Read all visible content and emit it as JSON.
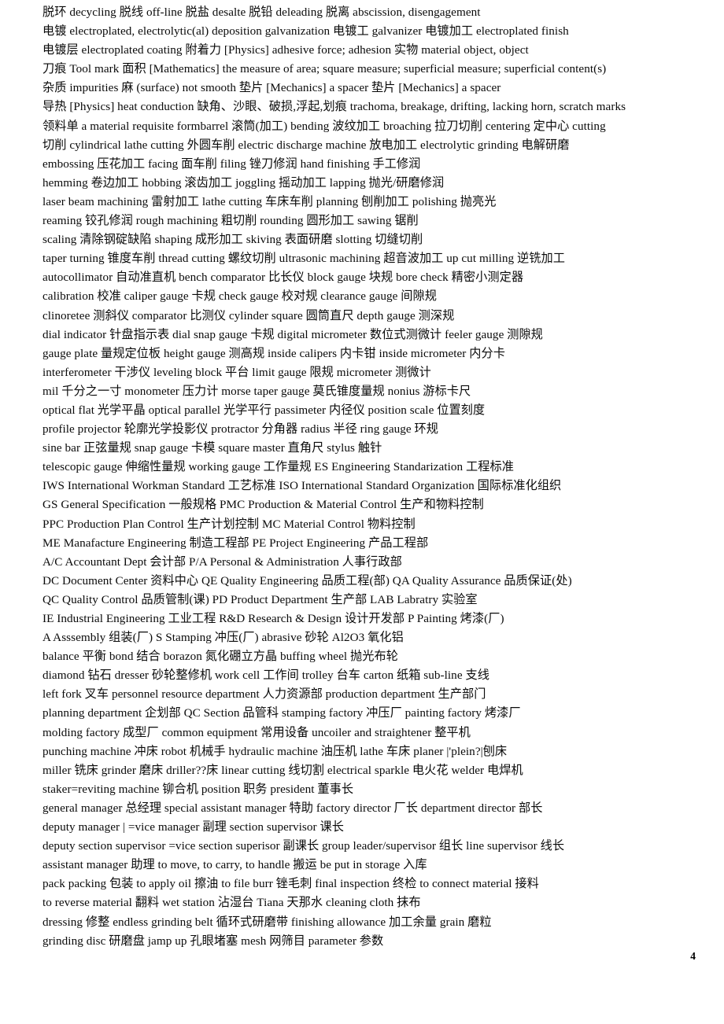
{
  "document": {
    "type": "bilingual-glossary",
    "page_number": "4",
    "lines": [
      "脱环  decycling 脱线  off-line 脱盐  desalte 脱铅  deleading 脱离  abscission, disengagement",
      "电镀  electroplated, electrolytic(al) deposition galvanization 电镀工  galvanizer 电镀加工  electroplated finish",
      "电镀层  electroplated coating  附着力  [Physics] adhesive force; adhesion 实物  material object, object",
      "刀痕  Tool mark 面积  [Mathematics] the measure of area; square measure; superficial measure; superficial content(s)",
      "杂质  impurities 麻  (surface) not smooth 垫片  [Mechanics] a spacer 垫片  [Mechanics] a spacer",
      "导热  [Physics] heat conduction 缺角、沙眼、破损,浮起,划痕  trachoma, breakage, drifting, lacking horn, scratch marks",
      "领料单  a material requisite formbarrel  滚筒(加工) bending  波纹加工  broaching  拉刀切削  centering  定中心  cutting",
      "切削  cylindrical lathe cutting  外圆车削  electric discharge machine  放电加工  electrolytic grinding  电解研磨",
      "embossing  压花加工  facing  面车削  filing  锉刀修润  hand finishing  手工修润",
      "hemming  卷边加工  hobbing  滚齿加工  joggling  摇动加工  lapping  抛光/研磨修润",
      "laser beam machining  雷射加工  lathe cutting  车床车削  planning  刨削加工  polishing  抛亮光",
      "reaming  铰孔修润  rough machining  粗切削  rounding  圆形加工  sawing  锯削",
      "scaling  清除钢碇缺陷  shaping  成形加工  skiving  表面研磨  slotting  切缝切削",
      "taper turning  锥度车削  thread cutting  螺纹切削  ultrasonic machining  超音波加工  up cut milling  逆铣加工",
      "autocollimator  自动准直机  bench comparator  比长仪  block gauge  块规  bore check  精密小测定器",
      "calibration  校准  caliper gauge 卡规  check gauge  校对规  clearance gauge  间隙规",
      "clinoretee  测斜仪  comparator  比测仪  cylinder square  圆筒直尺  depth gauge  测深规",
      "dial indicator  针盘指示表  dial snap gauge  卡规  digital micrometer  数位式测微计  feeler gauge  测隙规",
      "gauge plate  量规定位板  height gauge  测高规  inside calipers  内卡钳  inside micrometer  内分卡",
      "interferometer  干涉仪  leveling block  平台  limit gauge  限规  micrometer  测微计",
      "mil  千分之一寸  monometer  压力计  morse taper gauge  莫氏锥度量规  nonius  游标卡尺",
      "optical flat  光学平晶  optical parallel  光学平行  passimeter  内径仪  position scale  位置刻度",
      "profile projector  轮廓光学投影仪  protractor  分角器  radius  半径  ring gauge  环规",
      "sine bar  正弦量规  snap gauge  卡模  square master  直角尺  stylus  触针",
      "telescopic gauge  伸缩性量规  working gauge  工作量规  ES Engineering Standarization  工程标准",
      "IWS International Workman Standard  工艺标准  ISO International Standard Organization  国际标准化组织",
      "GS General Specification  一般规格  PMC Production & Material Control  生产和物料控制",
      "PPC Production Plan Control  生产计划控制  MC Material Control  物料控制",
      "ME Manafacture Engineering  制造工程部  PE Project Engineering  产品工程部",
      "A/C Accountant Dept  会计部  P/A Personal & Administration  人事行政部",
      "DC Document Center  资料中心  QE Quality Engineering  品质工程(部) QA Quality Assurance  品质保证(处)",
      "QC Quality Control  品质管制(课) PD Product Department  生产部  LAB Labratry  实验室",
      "IE Industrial Engineering  工业工程  R&D Research & Design  设计开发部  P Painting  烤漆(厂)",
      "A Asssembly  组装(厂) S Stamping  冲压(厂) abrasive  砂轮  Al2O3  氧化铝",
      "balance  平衡  bond  结合  borazon  氮化硼立方晶  buffing wheel  抛光布轮",
      "diamond  钻石  dresser  砂轮整修机 work cell 工作间  trolley 台车  carton 纸箱  sub-line 支线",
      "left fork 叉车  personnel resource department  人力资源部  production department 生产部门",
      "planning department 企划部  QC Section 品管科  stamping factory 冲压厂  painting factory 烤漆厂",
      "molding factory 成型厂  common equipment 常用设备  uncoiler and straightener 整平机",
      "punching machine  冲床  robot 机械手  hydraulic machine 油压机  lathe 车床  planer |'plein?|刨床",
      "miller 铣床  grinder 磨床  driller??床  linear cutting 线切割  electrical sparkle 电火花  welder 电焊机",
      "staker=reviting machine 铆合机  position 职务  president 董事长",
      "general manager 总经理  special assistant manager 特助  factory director 厂长  department director 部长",
      "deputy manager | =vice manager 副理  section supervisor 课长",
      "deputy section supervisor =vice section superisor 副课长  group leader/supervisor 组长  line supervisor 线长",
      "assistant manager 助理  to move, to carry, to handle 搬运  be put in storage 入库",
      "pack packing 包装  to apply oil 擦油  to file burr  锉毛刺  final inspection 终检  to connect material 接料",
      "to reverse material  翻料  wet station 沾湿台  Tiana 天那水  cleaning cloth 抹布",
      "dressing  修整  endless grinding belt  循环式研磨带  finishing allowance  加工余量  grain  磨粒",
      "grinding disc  研磨盘  jamp up  孔眼堵塞  mesh  网筛目  parameter  参数"
    ]
  }
}
